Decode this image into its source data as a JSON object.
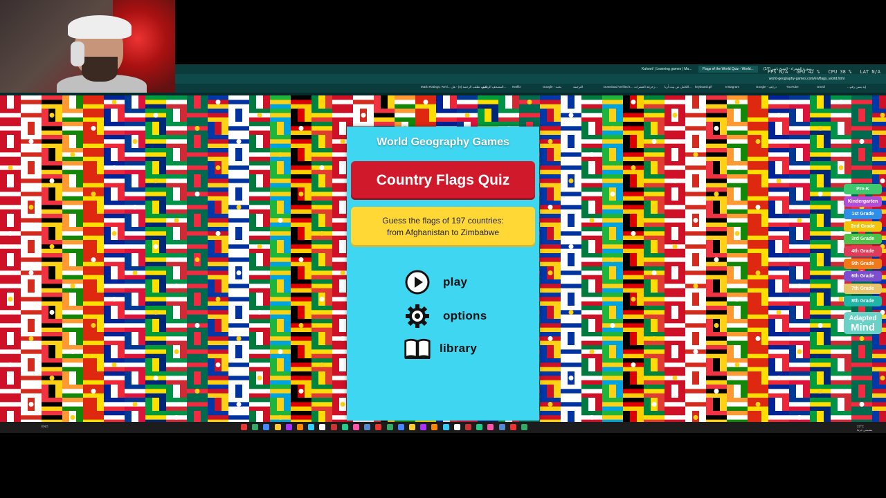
{
  "browser": {
    "tabs": [
      {
        "label": "Kahoot! | Learning games | Ma...",
        "active": false
      },
      {
        "label": "Flags of the World Quiz - World...",
        "active": true
      },
      {
        "label": "(2/7) سورة الشعراء - الشيخ ياسر...",
        "active": false
      }
    ],
    "url": "world-geography-games.com/en/flags_world.html",
    "bookmarks": [
      "IMDb Ratings, Revi...",
      "كيف تطلب الرحمة (4) - هل...",
      "المصحف الرقمي...",
      "Netflix",
      "Google - بحث",
      "الترجمة",
      "Download verified t...",
      "زخرفة العشرات...",
      "الكامل عن بيت أريا...",
      "keyboard.gif",
      "Instagram",
      "Google - درايف",
      "YouTube",
      "Gmail",
      "...إيه بسن رقم"
    ]
  },
  "stats": {
    "fps": "FPS  N/A",
    "gpu": "GPU  42 %",
    "cpu": "CPU  38 %",
    "lat": "LAT  N/A"
  },
  "card": {
    "site_title": "World Geography Games",
    "quiz_title": "Country Flags Quiz",
    "description_line1": "Guess the flags of 197 countries:",
    "description_line2": "from Afghanistan to Zimbabwe",
    "menu": {
      "play": {
        "label": "play",
        "icon": "play-icon"
      },
      "options": {
        "label": "options",
        "icon": "gear-icon"
      },
      "library": {
        "label": "library",
        "icon": "book-icon"
      }
    }
  },
  "grades": [
    {
      "label": "Pre-K",
      "color": "#3ec96e"
    },
    {
      "label": "Kindergarten",
      "color": "#b24fd8"
    },
    {
      "label": "1st Grade",
      "color": "#2e8ee8"
    },
    {
      "label": "2nd Grade",
      "color": "#f2c40c"
    },
    {
      "label": "3rd Grade",
      "color": "#4cc24a"
    },
    {
      "label": "4th Grade",
      "color": "#e23b5a"
    },
    {
      "label": "5th Grade",
      "color": "#f07a1a"
    },
    {
      "label": "6th Grade",
      "color": "#7b4fd0"
    },
    {
      "label": "7th Grade",
      "color": "#e8c46a"
    },
    {
      "label": "8th Grade",
      "color": "#1fb6a8"
    }
  ],
  "adapted_mind": {
    "line1": "Adapted",
    "line2": "Mind"
  },
  "taskbar": {
    "lang": "ENG",
    "clock": "23°C",
    "status": "مشمس جزئيا"
  }
}
